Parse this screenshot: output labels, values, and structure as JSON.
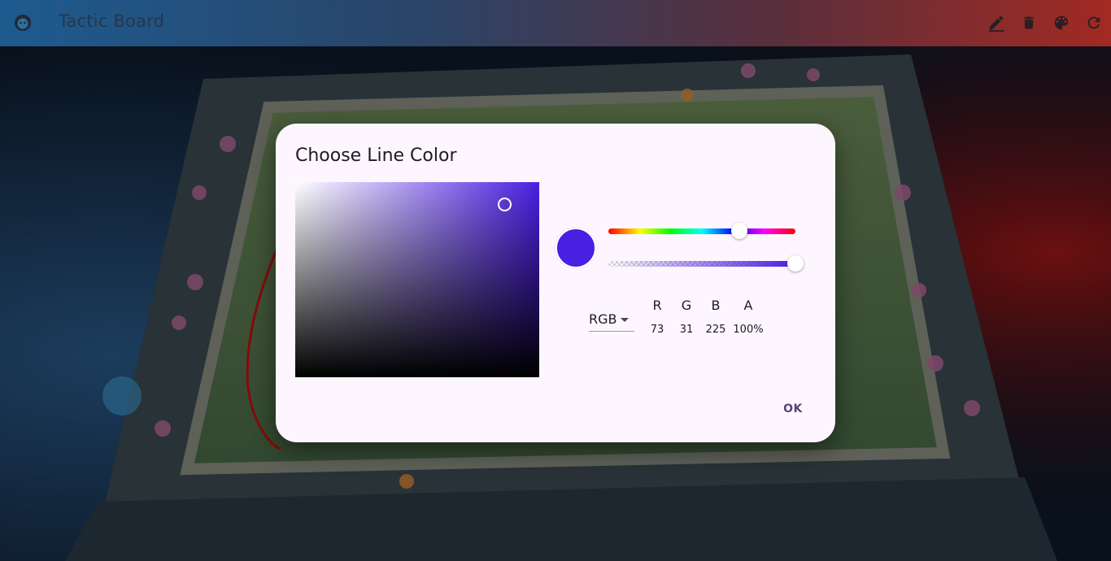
{
  "app": {
    "title": "Tactic Board",
    "logo_icon": "face-icon",
    "actions": [
      {
        "name": "edit-icon"
      },
      {
        "name": "delete-icon"
      },
      {
        "name": "palette-icon"
      },
      {
        "name": "refresh-icon"
      }
    ]
  },
  "dialog": {
    "title": "Choose Line Color",
    "selected_color": "#491FE1",
    "hue_color": "#4A1FE1",
    "mode": "RGB",
    "channels": [
      {
        "label": "R",
        "value": "73"
      },
      {
        "label": "G",
        "value": "31"
      },
      {
        "label": "B",
        "value": "225"
      },
      {
        "label": "A",
        "value": "100%"
      }
    ],
    "ok_label": "OK"
  }
}
